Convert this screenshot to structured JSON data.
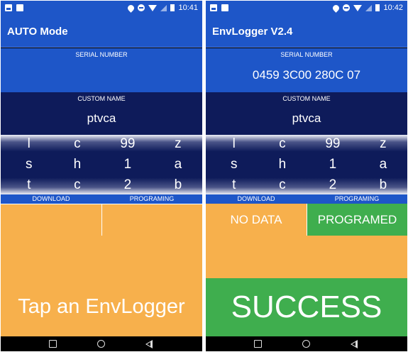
{
  "left": {
    "status_time": "10:41",
    "app_title": "AUTO Mode",
    "serial_label": "SERIAL NUMBER",
    "serial_value": "",
    "custom_name_label": "CUSTOM NAME",
    "custom_name_value": "ptvca",
    "picker": [
      [
        "l",
        "s",
        "t"
      ],
      [
        "c",
        "h",
        "c"
      ],
      [
        "99",
        "1",
        "2"
      ],
      [
        "z",
        "a",
        "b"
      ]
    ],
    "download_label": "DOWNLOAD",
    "programing_label": "PROGRAMING",
    "download_value": "",
    "programing_value": "",
    "bottom_text": "Tap an EnvLogger"
  },
  "right": {
    "status_time": "10:42",
    "app_title": "EnvLogger V2.4",
    "serial_label": "SERIAL NUMBER",
    "serial_value": "0459 3C00 280C 07",
    "custom_name_label": "CUSTOM NAME",
    "custom_name_value": "ptvca",
    "picker": [
      [
        "l",
        "s",
        "t"
      ],
      [
        "c",
        "h",
        "c"
      ],
      [
        "99",
        "1",
        "2"
      ],
      [
        "z",
        "a",
        "b"
      ]
    ],
    "download_label": "DOWNLOAD",
    "programing_label": "PROGRAMING",
    "download_value": "NO DATA",
    "programing_value": "PROGRAMED",
    "result_text": "SUCCESS"
  },
  "colors": {
    "primary_blue": "#1e56c8",
    "dark_navy": "#0e1b5a",
    "orange": "#f7b04c",
    "green": "#3fae4e"
  },
  "icons": {
    "status_bar": [
      "gallery-icon",
      "sd-card-icon",
      "location-icon",
      "do-not-disturb-icon",
      "wifi-icon",
      "signal-icon",
      "battery-icon"
    ],
    "nav_bar": [
      "recents-icon",
      "home-icon",
      "back-icon"
    ]
  }
}
